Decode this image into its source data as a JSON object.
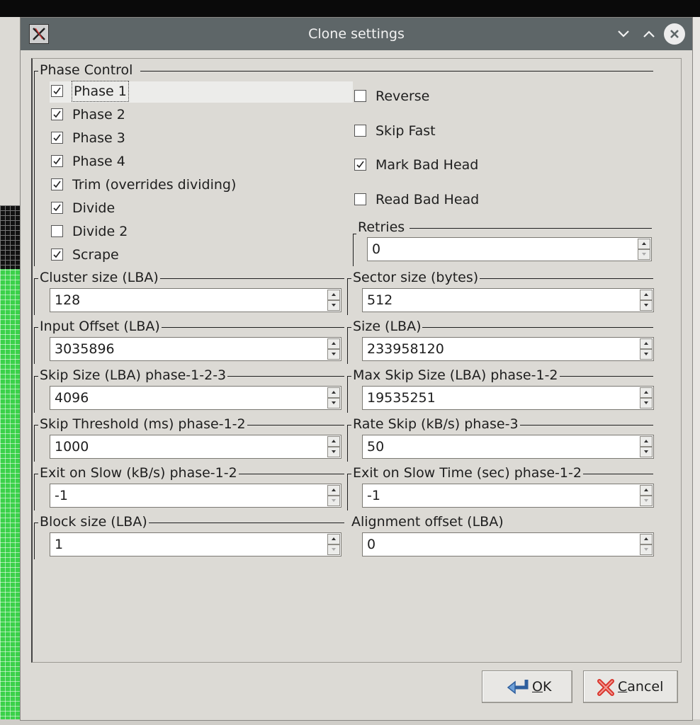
{
  "window": {
    "title": "Clone settings",
    "icon": "app-x-icon",
    "controls": [
      "minimize-icon",
      "maximize-icon",
      "close-icon"
    ]
  },
  "phase_control": {
    "group_label": "Phase Control",
    "left_checks": [
      {
        "label": "Phase 1",
        "checked": true,
        "focused": true
      },
      {
        "label": "Phase 2",
        "checked": true
      },
      {
        "label": "Phase 3",
        "checked": true
      },
      {
        "label": "Phase 4",
        "checked": true
      },
      {
        "label": "Trim (overrides dividing)",
        "checked": true
      },
      {
        "label": "Divide",
        "checked": true
      },
      {
        "label": "Divide 2",
        "checked": false
      },
      {
        "label": "Scrape",
        "checked": true
      }
    ],
    "right_checks": [
      {
        "label": "Reverse",
        "checked": false
      },
      {
        "label": "Skip Fast",
        "checked": false
      },
      {
        "label": "Mark Bad Head",
        "checked": true
      },
      {
        "label": "Read Bad Head",
        "checked": false
      }
    ],
    "retries": {
      "label": "Retries",
      "value": "0"
    }
  },
  "fields": {
    "cluster_size": {
      "label": "Cluster size (LBA)",
      "value": "128"
    },
    "sector_size": {
      "label": "Sector size (bytes)",
      "value": "512"
    },
    "input_offset": {
      "label": "Input Offset (LBA)",
      "value": "3035896"
    },
    "size": {
      "label": "Size (LBA)",
      "value": "233958120"
    },
    "skip_size": {
      "label": "Skip Size (LBA) phase-1-2-3",
      "value": "4096"
    },
    "max_skip_size": {
      "label": "Max Skip Size (LBA) phase-1-2",
      "value": "19535251"
    },
    "skip_threshold": {
      "label": "Skip Threshold (ms) phase-1-2",
      "value": "1000"
    },
    "rate_skip": {
      "label": "Rate Skip (kB/s) phase-3",
      "value": "50"
    },
    "exit_on_slow": {
      "label": "Exit on Slow (kB/s) phase-1-2",
      "value": "-1"
    },
    "exit_on_slow_time": {
      "label": "Exit on Slow Time (sec) phase-1-2",
      "value": "-1"
    },
    "block_size": {
      "label": "Block size (LBA)",
      "value": "1"
    },
    "alignment_offset": {
      "label": "Alignment offset (LBA)",
      "value": "0"
    }
  },
  "buttons": {
    "ok": {
      "label": "OK",
      "mnemonic": "O",
      "rest": "K",
      "icon": "enter-arrow-icon"
    },
    "cancel": {
      "label": "Cancel",
      "mnemonic": "C",
      "rest": "ancel",
      "icon": "red-x-icon"
    }
  }
}
